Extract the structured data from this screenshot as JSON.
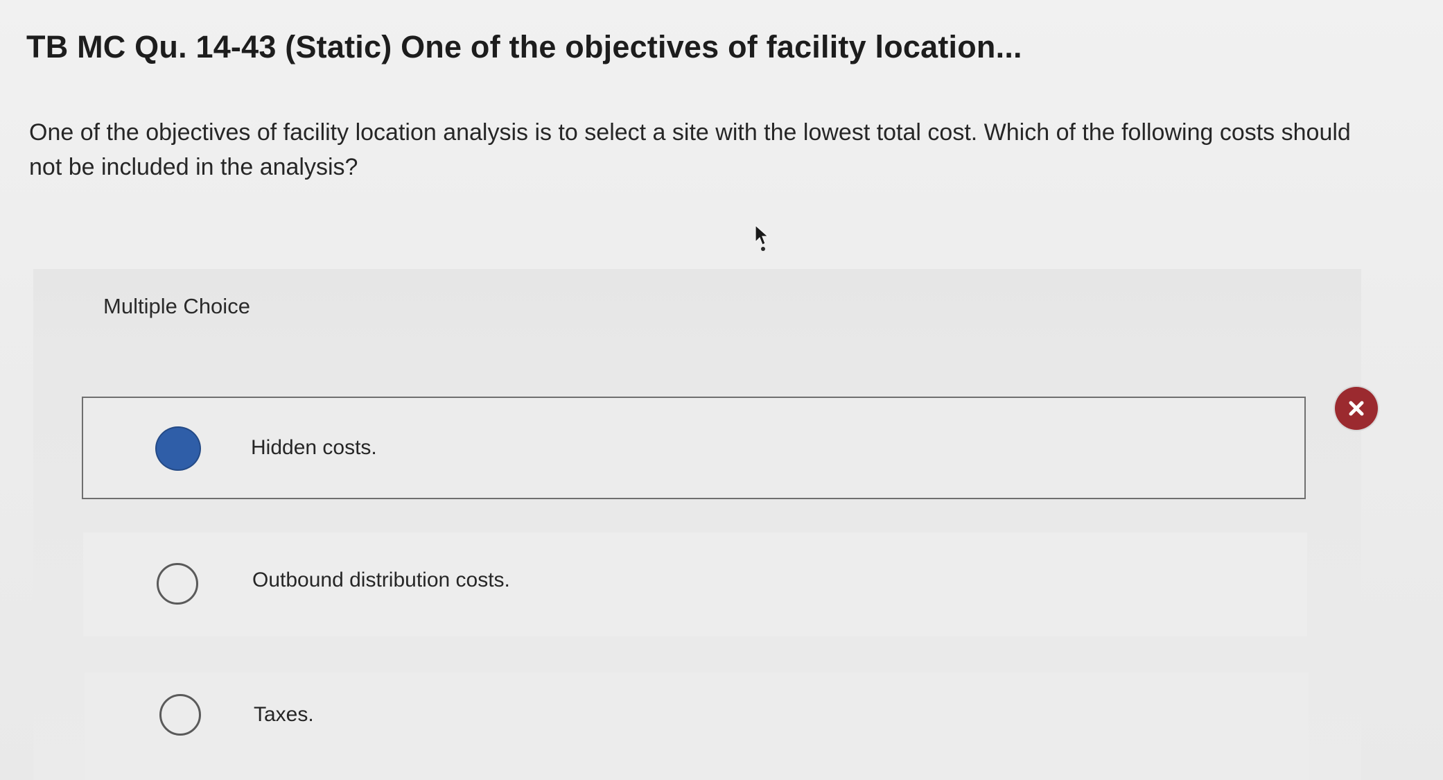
{
  "question": {
    "title": "TB MC Qu. 14-43 (Static) One of the objectives of facility location...",
    "text": "One of the objectives of facility location analysis is to select a site with the lowest total cost. Which of the following costs should not be included in the analysis?"
  },
  "multiple_choice": {
    "label": "Multiple Choice",
    "options": [
      {
        "label": "Hidden costs.",
        "selected": true,
        "marked_incorrect": true
      },
      {
        "label": "Outbound distribution costs.",
        "selected": false
      },
      {
        "label": "Taxes.",
        "selected": false
      }
    ]
  },
  "icons": {
    "incorrect": "close-x-icon",
    "pointer": "mouse-pointer-icon"
  },
  "colors": {
    "selected_radio": "#2f5ea8",
    "incorrect_badge": "#9b2a2f"
  }
}
